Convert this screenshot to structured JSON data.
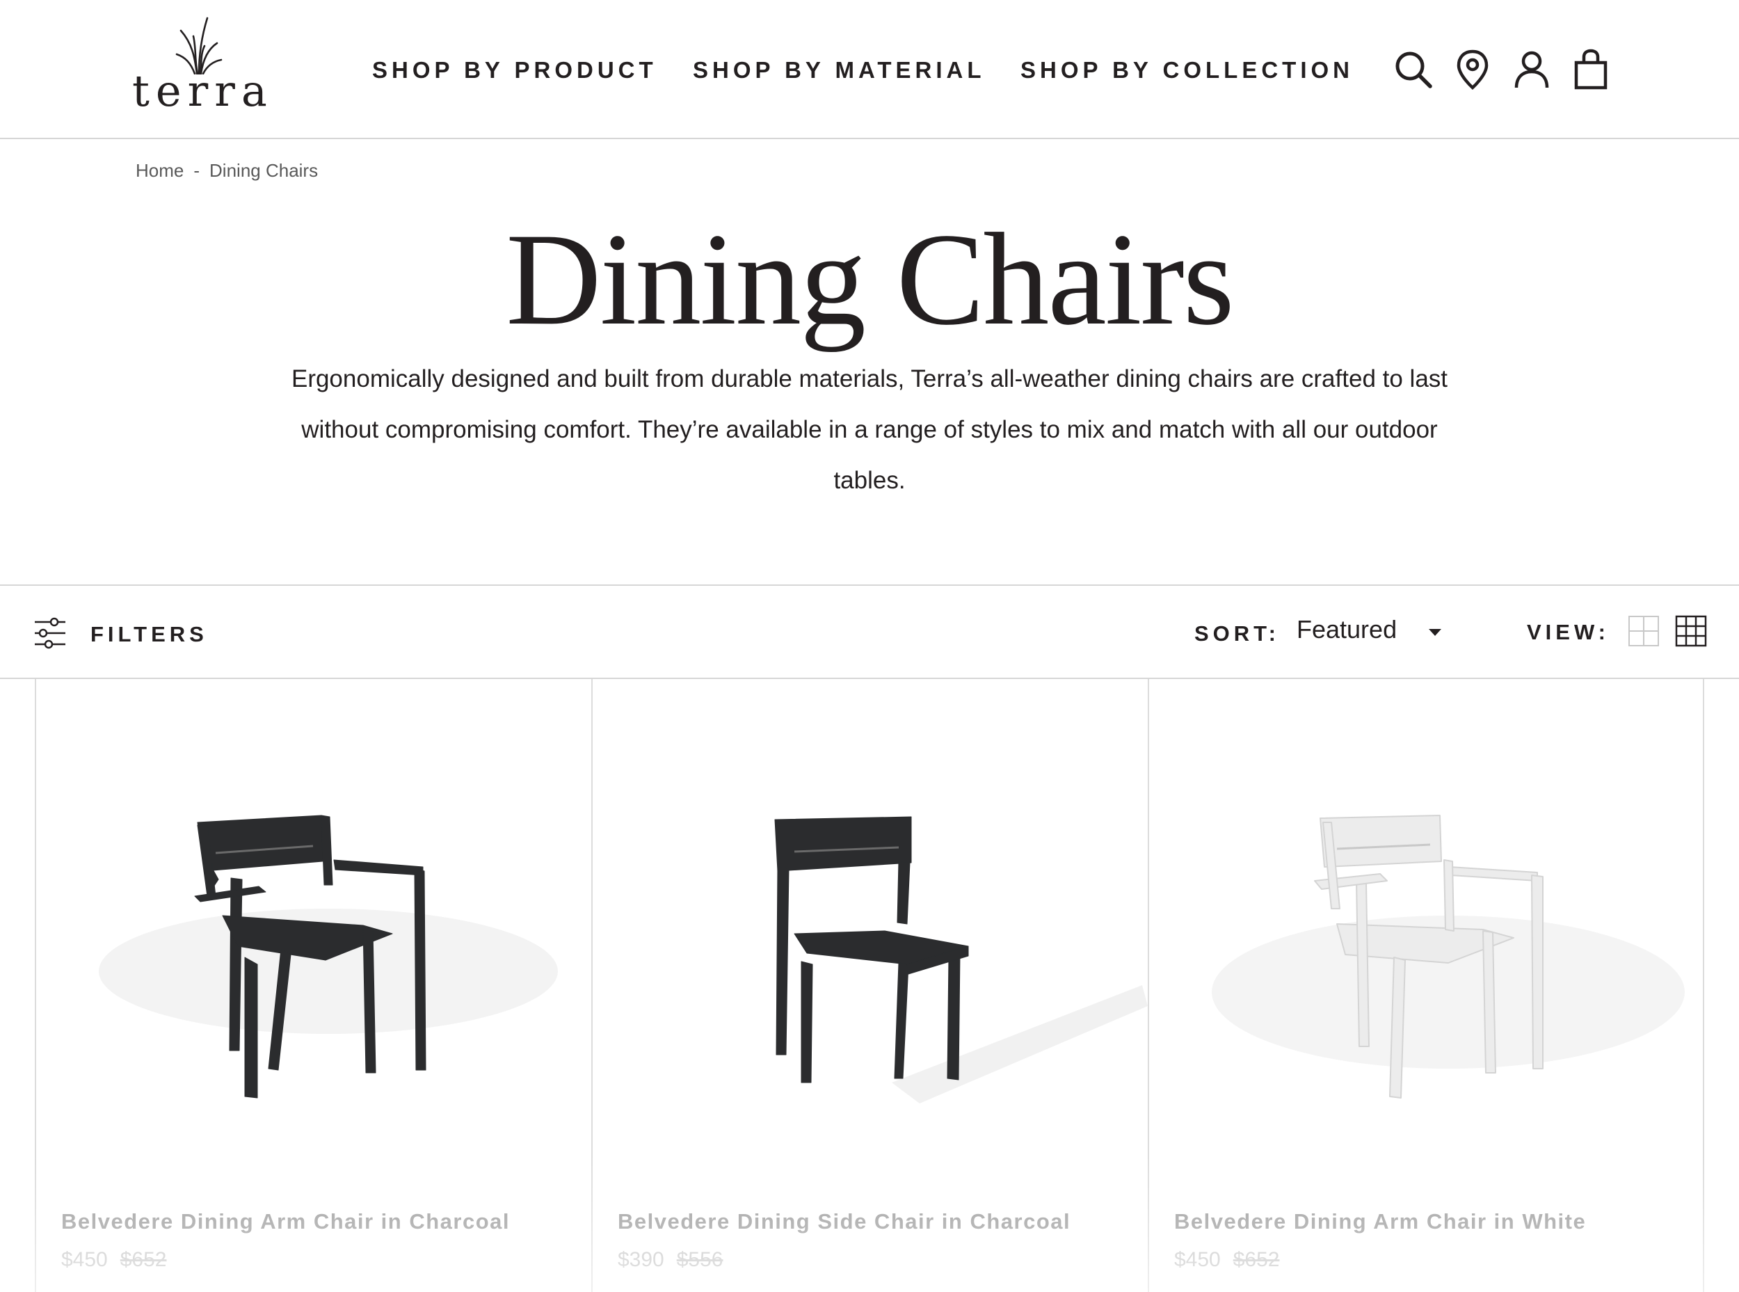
{
  "header": {
    "logo_text": "terra",
    "nav": [
      "SHOP BY PRODUCT",
      "SHOP BY MATERIAL",
      "SHOP BY COLLECTION"
    ],
    "icons": [
      "search-icon",
      "location-pin-icon",
      "account-icon",
      "shopping-bag-icon"
    ]
  },
  "breadcrumb": {
    "home": "Home",
    "separator": "-",
    "current": "Dining Chairs"
  },
  "page": {
    "title": "Dining Chairs",
    "description": "Ergonomically designed and built from durable materials, Terra’s all-weather dining chairs are crafted to last without compromising comfort. They’re available in a range of styles to mix and match with all our outdoor tables."
  },
  "toolbar": {
    "filters_label": "FILTERS",
    "sort_label": "SORT:",
    "sort_value": "Featured",
    "view_label": "VIEW:"
  },
  "products": [
    {
      "name": "Belvedere Dining Arm Chair in Charcoal",
      "price": "$450",
      "compare_price": "$652",
      "color": "#2b2c2e"
    },
    {
      "name": "Belvedere Dining Side Chair in Charcoal",
      "price": "$390",
      "compare_price": "$556",
      "color": "#2b2c2e"
    },
    {
      "name": "Belvedere Dining Arm Chair in White",
      "price": "$450",
      "compare_price": "$652",
      "color": "#ececec"
    }
  ],
  "colors": {
    "text": "#231f20",
    "divider": "#d6d6d6",
    "muted": "#9b9b9b"
  }
}
